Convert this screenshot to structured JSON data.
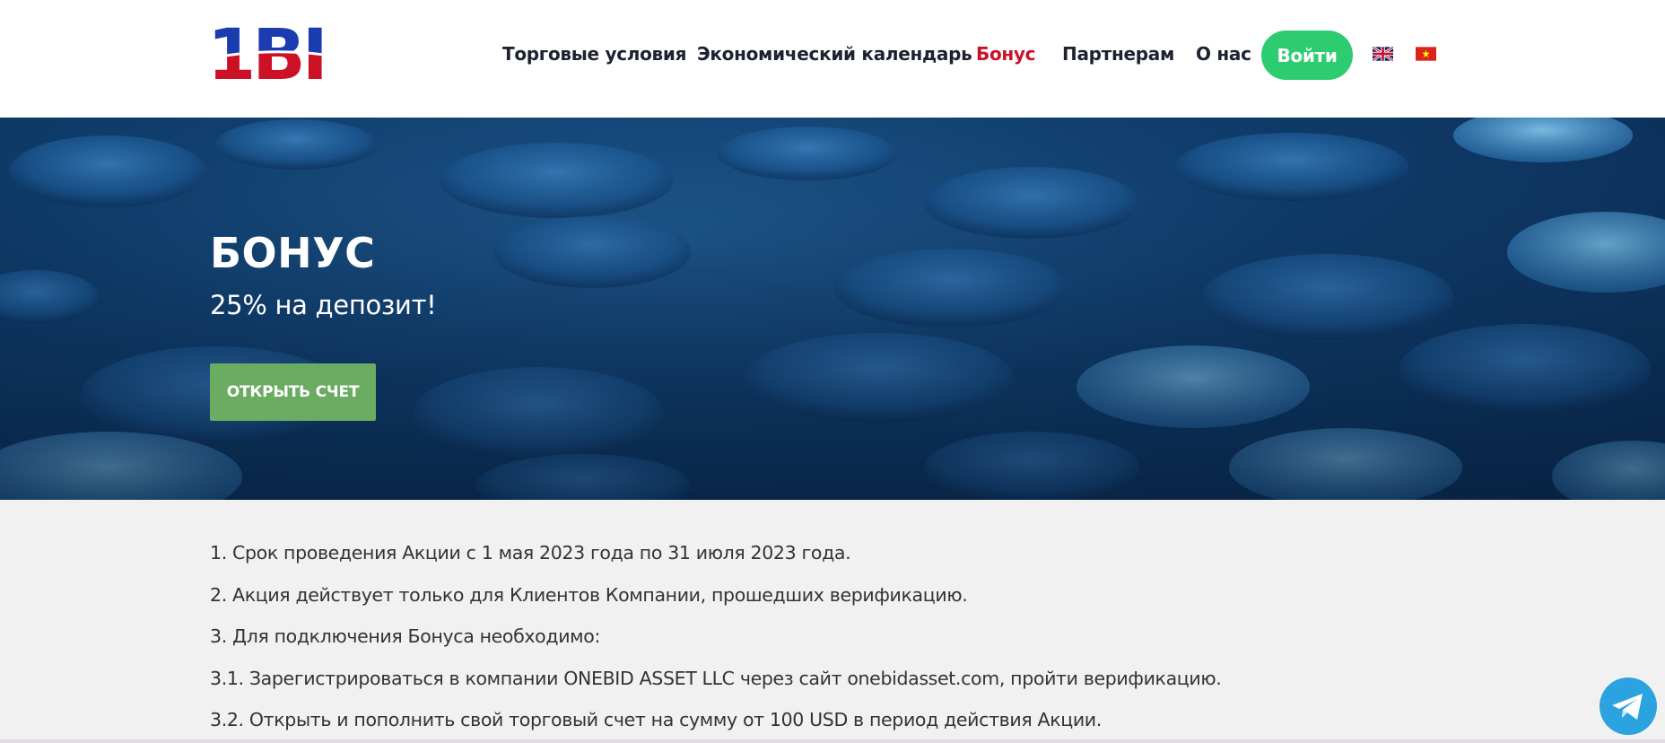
{
  "header": {
    "logo_text": "1BID",
    "nav": [
      {
        "label": "Торговые условия",
        "active": false
      },
      {
        "label": "Экономический календарь",
        "active": false
      },
      {
        "label": "Бонус",
        "active": true
      },
      {
        "label": "Партнерам",
        "active": false
      },
      {
        "label": "О нас",
        "active": false
      }
    ],
    "login_label": "Войти",
    "languages": [
      {
        "icon": "uk-flag-icon"
      },
      {
        "icon": "vietnam-flag-icon"
      }
    ]
  },
  "hero": {
    "title": "БОНУС",
    "subtitle": "25% на депозит!",
    "button_label": "ОТКРЫТЬ СЧЕТ"
  },
  "content": {
    "paragraphs": [
      "1. Срок проведения Акции с 1 мая 2023 года по 31 июля 2023 года.",
      "2. Акция действует только для Клиентов Компании, прошедших верификацию.",
      "3. Для подключения Бонуса необходимо:",
      "3.1. Зарегистрироваться в компании ONEBID ASSET LLC через сайт onebidasset.com, пройти верификацию.",
      "3.2. Открыть и пополнить свой торговый счет на сумму от 100 USD в период действия Акции."
    ]
  },
  "widgets": {
    "telegram_icon": "telegram-icon"
  },
  "colors": {
    "accent_red": "#cc1126",
    "login_green": "#2ecc71",
    "cta_green": "#6aac62",
    "logo_blue": "#1a3cb0",
    "telegram_blue": "#2aa3e0"
  }
}
